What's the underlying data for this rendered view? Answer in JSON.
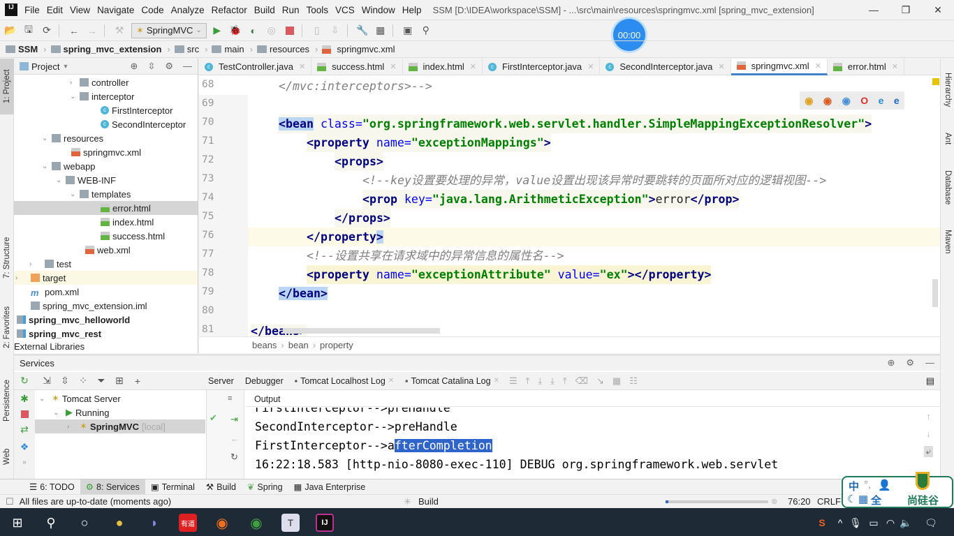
{
  "window": {
    "title": "SSM [D:\\IDEA\\workspace\\SSM] - ...\\src\\main\\resources\\springmvc.xml [spring_mvc_extension]",
    "menu": [
      "File",
      "Edit",
      "View",
      "Navigate",
      "Code",
      "Analyze",
      "Refactor",
      "Build",
      "Run",
      "Tools",
      "VCS",
      "Window",
      "Help"
    ]
  },
  "toolbar": {
    "run_config": "SpringMVC"
  },
  "timer": "00:00",
  "navbar": [
    "SSM",
    "spring_mvc_extension",
    "src",
    "main",
    "resources",
    "springmvc.xml"
  ],
  "left_strip": [
    "1: Project",
    "7: Structure",
    "2: Favorites",
    "Persistence",
    "Web"
  ],
  "right_strip": [
    "Hierarchy",
    "Ant",
    "Database",
    "Maven"
  ],
  "project": {
    "title": "Project",
    "tree": [
      {
        "label": "controller",
        "icon": "folder",
        "expanded": false
      },
      {
        "label": "interceptor",
        "icon": "folder",
        "expanded": true
      },
      {
        "label": "FirstInterceptor",
        "icon": "class"
      },
      {
        "label": "SecondInterceptor",
        "icon": "class"
      },
      {
        "label": "resources",
        "icon": "folder",
        "expanded": true
      },
      {
        "label": "springmvc.xml",
        "icon": "xml"
      },
      {
        "label": "webapp",
        "icon": "folder",
        "expanded": true
      },
      {
        "label": "WEB-INF",
        "icon": "folder",
        "expanded": true
      },
      {
        "label": "templates",
        "icon": "folder",
        "expanded": true
      },
      {
        "label": "error.html",
        "icon": "html",
        "selected": true
      },
      {
        "label": "index.html",
        "icon": "html"
      },
      {
        "label": "success.html",
        "icon": "html"
      },
      {
        "label": "web.xml",
        "icon": "xml"
      },
      {
        "label": "test",
        "icon": "folder",
        "expanded": false
      },
      {
        "label": "target",
        "icon": "folder-orange",
        "expanded": false
      },
      {
        "label": "pom.xml",
        "icon": "maven"
      },
      {
        "label": "spring_mvc_extension.iml",
        "icon": "iml"
      },
      {
        "label": "spring_mvc_helloworld",
        "icon": "module"
      },
      {
        "label": "spring_mvc_rest",
        "icon": "module"
      },
      {
        "label": "External Libraries",
        "icon": "library"
      }
    ]
  },
  "editor": {
    "tabs": [
      {
        "label": "TestController.java",
        "icon": "class"
      },
      {
        "label": "success.html",
        "icon": "html"
      },
      {
        "label": "index.html",
        "icon": "html"
      },
      {
        "label": "FirstInterceptor.java",
        "icon": "class"
      },
      {
        "label": "SecondInterceptor.java",
        "icon": "class"
      },
      {
        "label": "springmvc.xml",
        "icon": "xml",
        "active": true
      },
      {
        "label": "error.html",
        "icon": "html"
      }
    ],
    "lines": {
      "l68": {
        "num": "68",
        "c": "</mvc:interceptors>-->"
      },
      "l69": {
        "num": "69"
      },
      "l70": {
        "num": "70",
        "t1": "<bean",
        "a1": " class=",
        "s1": "\"org.springframework.web.servlet.handler.SimpleMappingExceptionResolver\"",
        "t2": ">"
      },
      "l71": {
        "num": "71",
        "t1": "<property",
        "a1": " name=",
        "s1": "\"exceptionMappings\"",
        "t2": ">"
      },
      "l72": {
        "num": "72",
        "t1": "<props>"
      },
      "l73": {
        "num": "73",
        "c": "<!--key设置要处理的异常，value设置出现该异常时要跳转的页面所对应的逻辑视图-->"
      },
      "l74": {
        "num": "74",
        "t1": "<prop",
        "a1": " key=",
        "s1": "\"java.lang.ArithmeticException\"",
        "t2": ">",
        "txt": "error",
        "t3": "</prop>"
      },
      "l75": {
        "num": "75",
        "t1": "</props>"
      },
      "l76": {
        "num": "76",
        "t1": "</property",
        "t2": ">"
      },
      "l77": {
        "num": "77",
        "c": "<!--设置共享在请求域中的异常信息的属性名-->"
      },
      "l78": {
        "num": "78",
        "t1": "<property",
        "a1": " name=",
        "s1": "\"exceptionAttribute\"",
        "a2": " value=",
        "s2": "\"ex\"",
        "t2": "></property>"
      },
      "l79": {
        "num": "79",
        "t1": "</bean>"
      },
      "l80": {
        "num": "80"
      },
      "l81": {
        "num": "81",
        "t1": "</beans>"
      }
    },
    "breadcrumb": [
      "beans",
      "bean",
      "property"
    ],
    "browser_icons": [
      "chrome-icon",
      "firefox-icon",
      "safari-icon",
      "opera-icon",
      "ie-icon",
      "edge-icon"
    ]
  },
  "services": {
    "title": "Services",
    "tree": {
      "server": "Tomcat Server",
      "state": "Running",
      "app": "SpringMVC",
      "app_suffix": "[local]"
    },
    "tabs": [
      "Server",
      "Debugger",
      "Tomcat Localhost Log",
      "Tomcat Catalina Log"
    ],
    "output_label": "Output",
    "output": {
      "l1": "FirstInterceptor-->preHandle",
      "l2": "SecondInterceptor-->preHandle",
      "l3a": "FirstInterceptor-->a",
      "l3b": "fterCompletion",
      "l4": "16:22:18.583 [http-nio-8080-exec-110] DEBUG org.springframework.web.servlet"
    }
  },
  "bottom_tabs": [
    {
      "label": "6: TODO"
    },
    {
      "label": "8: Services",
      "active": true
    },
    {
      "label": "Terminal"
    },
    {
      "label": "Build"
    },
    {
      "label": "Spring"
    },
    {
      "label": "Java Enterprise"
    }
  ],
  "status": {
    "message": "All files are up-to-date (moments ago)",
    "task": "Build",
    "position": "76:20",
    "line_sep": "CRLF"
  },
  "ime": {
    "lang": "中",
    "width": "全",
    "brand": "尚硅谷"
  },
  "colors": {
    "accent": "#4083c9",
    "selection": "#2f65ca",
    "tag": "#000080",
    "string": "#008000",
    "attr": "#0000ff"
  }
}
